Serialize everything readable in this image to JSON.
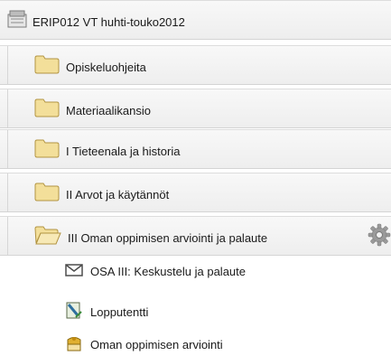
{
  "course": {
    "label": "ERIP012 VT huhti-touko2012",
    "icon": "course-icon"
  },
  "folders": [
    {
      "label": "Opiskeluohjeita",
      "icon": "folder-closed-icon"
    },
    {
      "label": "Materiaalikansio",
      "icon": "folder-closed-icon"
    },
    {
      "label": "I Tieteenala ja historia",
      "icon": "folder-closed-icon"
    },
    {
      "label": "II Arvot ja käytännöt",
      "icon": "folder-closed-icon"
    },
    {
      "label": "III Oman oppimisen arviointi ja palaute",
      "icon": "folder-open-icon",
      "action_icon": "gear-icon"
    }
  ],
  "items": [
    {
      "label": "OSA III: Keskustelu ja palaute",
      "icon": "envelope-icon"
    },
    {
      "label": "Lopputentti",
      "icon": "exam-icon"
    },
    {
      "label": "Oman oppimisen arviointi",
      "icon": "survey-icon"
    }
  ],
  "colors": {
    "folder": "#f3df9a",
    "folder_stroke": "#b29442",
    "row_bg": "#f1f1f1"
  }
}
